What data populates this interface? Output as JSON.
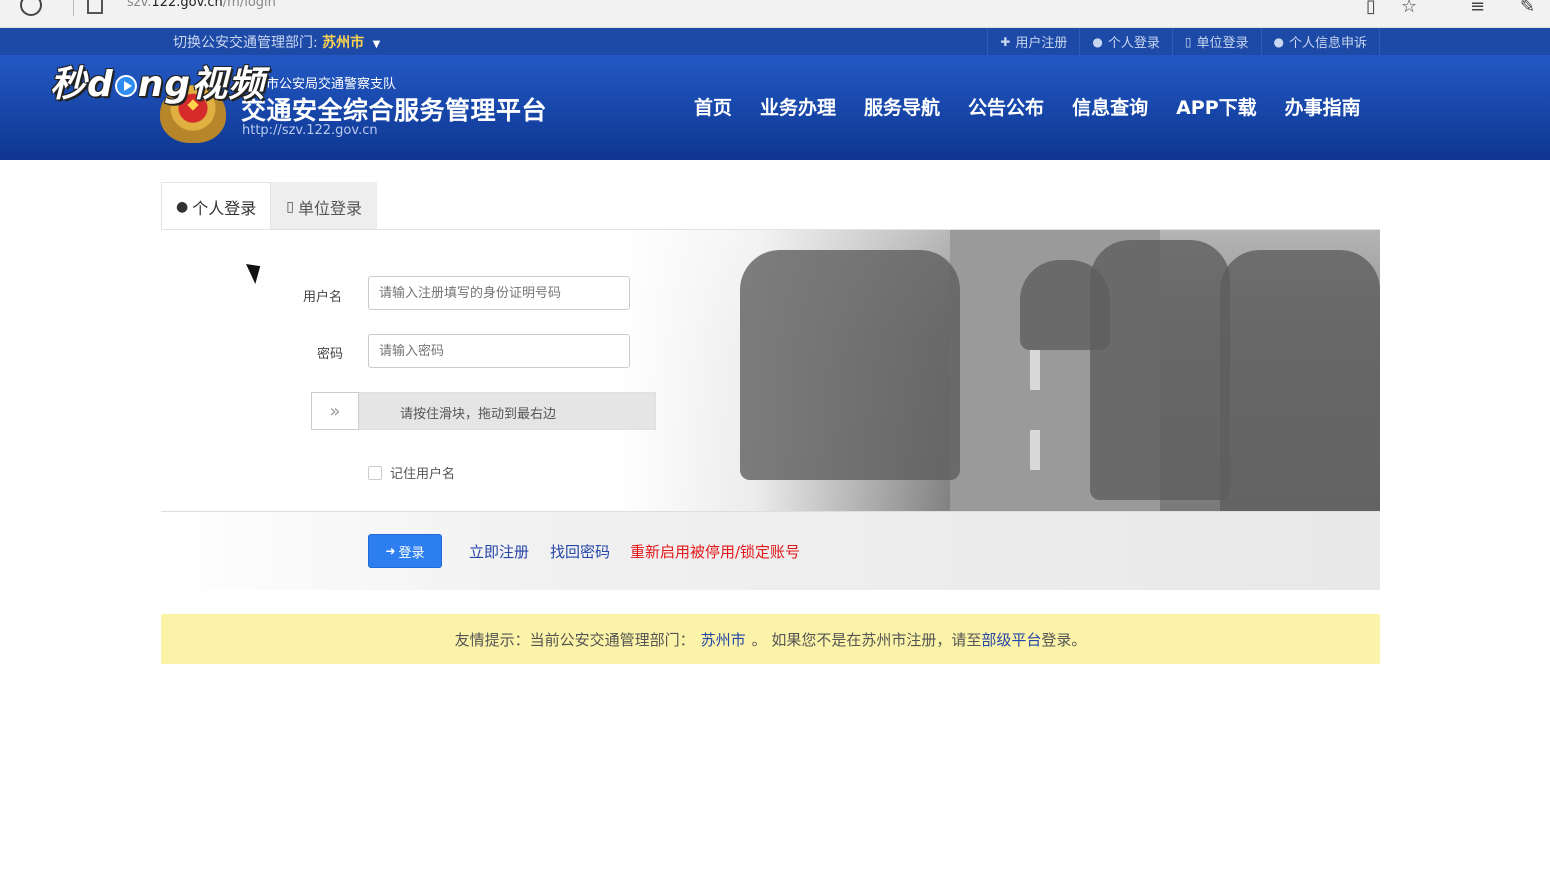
{
  "browser": {
    "url_prefix": "szv.",
    "url_host": "122.gov.cn",
    "url_path": "/m/login"
  },
  "watermark": {
    "text_a": "秒d",
    "text_b": "ng视频"
  },
  "topbar": {
    "dept_label": "切换公安交通管理部门:",
    "dept_city": "苏州市",
    "links": [
      {
        "label": "用户注册",
        "icon": "plus-icon"
      },
      {
        "label": "个人登录",
        "icon": "user-icon"
      },
      {
        "label": "单位登录",
        "icon": "building-icon"
      },
      {
        "label": "个人信息申诉",
        "icon": "user-icon"
      }
    ]
  },
  "header": {
    "org_name": "市公安局交通警察支队",
    "site_title": "交通安全综合服务管理平台",
    "site_url": "http://szv.122.gov.cn",
    "nav": [
      "首页",
      "业务办理",
      "服务导航",
      "公告公布",
      "信息查询",
      "APP下载",
      "办事指南"
    ]
  },
  "login": {
    "tabs": [
      {
        "label": "个人登录",
        "icon": "user-icon",
        "active": true
      },
      {
        "label": "单位登录",
        "icon": "building-icon",
        "active": false
      }
    ],
    "username_label": "用户名",
    "username_placeholder": "请输入注册填写的身份证明号码",
    "password_label": "密码",
    "password_placeholder": "请输入密码",
    "slider_hint": "请按住滑块，拖动到最右边",
    "slider_handle": "»",
    "remember_label": "记住用户名",
    "login_button": "登录",
    "register_link": "立即注册",
    "recover_link": "找回密码",
    "reactivate_link": "重新启用被停用/锁定账号"
  },
  "notice": {
    "prefix": "友情提示：当前公安交通管理部门：",
    "city": "苏州市",
    "middle": "。 如果您不是在苏州市注册，请至",
    "platform_link": "部级平台",
    "suffix": "登录。"
  },
  "colors": {
    "header_blue": "#1746a8",
    "accent_yellow": "#ffd34d",
    "login_button": "#2d7ff0",
    "link_blue": "#2446a8",
    "link_red": "#e5161a",
    "notice_bg": "#fbf3a8"
  }
}
